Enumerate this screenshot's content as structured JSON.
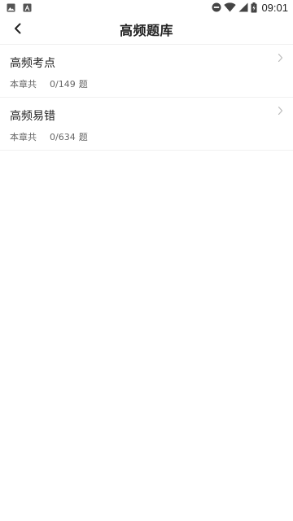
{
  "status_bar": {
    "time": "09:01",
    "left_icons": [
      "image-icon",
      "font-a-icon"
    ],
    "right_icons": [
      "do-not-disturb-icon",
      "wifi-icon",
      "signal-icon",
      "battery-icon"
    ]
  },
  "header": {
    "back_icon": "chevron-left-icon",
    "title": "高频题库"
  },
  "items": [
    {
      "title": "高频考点",
      "meta_label": "本章共",
      "count": "0/149",
      "unit": "题"
    },
    {
      "title": "高频易错",
      "meta_label": "本章共",
      "count": "0/634",
      "unit": "题"
    }
  ],
  "colors": {
    "background": "#ffffff",
    "title_text": "#222222",
    "meta_text": "#666666",
    "divider": "#f1f1f1",
    "chevron": "#bbbbbb"
  }
}
